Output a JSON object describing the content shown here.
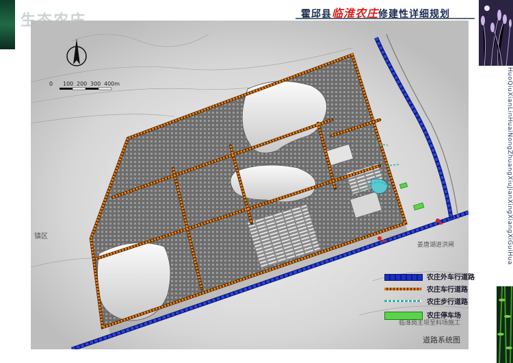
{
  "header": {
    "brand_title": "生态农庄",
    "plan_title_prefix": "霍邱县",
    "plan_title_highlight": "临淮农庄",
    "plan_title_suffix": "修建性详细规划",
    "vertical_text": "HuoQiuXianLinHuaiNongZhuangXiuJianXingXiangXiGuiHua"
  },
  "map": {
    "scale_labels": [
      "0",
      "100",
      "200",
      "300",
      "400m"
    ],
    "place_labels": {
      "district": "镇区",
      "flood_channel": "姜唐湖进洪闸",
      "lower_caption": "临淮岗主坝至料场施工"
    },
    "colors": {
      "outer_road": "#1a2ec8",
      "main_road": "#e07a18",
      "walk_path": "#37b3a8",
      "parking": "#5cd34a"
    }
  },
  "legend": [
    {
      "label": "农庄外车行道路",
      "style": "outer"
    },
    {
      "label": "农庄车行道路",
      "style": "road"
    },
    {
      "label": "农庄步行道路",
      "style": "walk"
    },
    {
      "label": "农庄停车场",
      "style": "park"
    }
  ],
  "footer": {
    "caption": "道路系统图"
  }
}
